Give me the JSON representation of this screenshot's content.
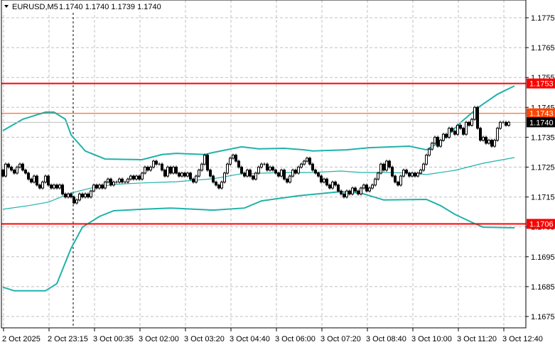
{
  "header": {
    "symbol_timeframe": "EURUSD,M5",
    "ohlc": "1.1740 1.1740 1.1739 1.1740",
    "menu_icon": "triangle-down-icon"
  },
  "chart_data": {
    "type": "candlestick",
    "title": "EURUSD,M5",
    "ylim": [
      1.1668,
      1.1782
    ],
    "grid": true,
    "price_ticks": [
      "1.1775",
      "1.1765",
      "1.1755",
      "1.1745",
      "1.1735",
      "1.1725",
      "1.1715",
      "1.1705",
      "1.1695",
      "1.1685",
      "1.1675"
    ],
    "time_ticks": [
      "2 Oct 2025",
      "2 Oct 23:15",
      "3 Oct 00:35",
      "3 Oct 02:00",
      "3 Oct 03:20",
      "3 Oct 04:40",
      "3 Oct 06:00",
      "3 Oct 07:20",
      "3 Oct 08:40",
      "3 Oct 10:00",
      "3 Oct 11:20",
      "3 Oct 12:40"
    ],
    "colors": {
      "bull_body": "#ffffff",
      "bear_body": "#000000",
      "candle_outline": "#000000",
      "bands": "#20b2aa",
      "grid": "#c0c0c0"
    },
    "closes": [
      1.1722,
      1.1726,
      1.1725,
      1.1724,
      1.1723,
      1.1725,
      1.1726,
      1.1724,
      1.1723,
      1.1721,
      1.172,
      1.1722,
      1.1719,
      1.1718,
      1.172,
      1.1722,
      1.1719,
      1.1718,
      1.1719,
      1.1718,
      1.1719,
      1.1716,
      1.1715,
      1.1716,
      1.1715,
      1.1713,
      1.1714,
      1.1716,
      1.1715,
      1.1716,
      1.1715,
      1.1717,
      1.1719,
      1.1718,
      1.1719,
      1.1718,
      1.172,
      1.1721,
      1.1719,
      1.172,
      1.172,
      1.1721,
      1.172,
      1.172,
      1.1721,
      1.1722,
      1.1721,
      1.1722,
      1.1721,
      1.1723,
      1.1725,
      1.1724,
      1.1725,
      1.1727,
      1.1726,
      1.1726,
      1.1724,
      1.1722,
      1.1725,
      1.1723,
      1.1725,
      1.1723,
      1.1722,
      1.1723,
      1.1722,
      1.1723,
      1.1721,
      1.172,
      1.1722,
      1.1724,
      1.1726,
      1.1729,
      1.1724,
      1.1722,
      1.172,
      1.1719,
      1.1718,
      1.172,
      1.1723,
      1.1726,
      1.1728,
      1.1729,
      1.1727,
      1.1725,
      1.1723,
      1.1722,
      1.1724,
      1.1722,
      1.1721,
      1.1723,
      1.1725,
      1.1726,
      1.1726,
      1.1724,
      1.1725,
      1.1724,
      1.1723,
      1.1722,
      1.1724,
      1.1721,
      1.172,
      1.1722,
      1.1724,
      1.1723,
      1.1725,
      1.1726,
      1.1727,
      1.1728,
      1.1726,
      1.1724,
      1.1723,
      1.1722,
      1.172,
      1.1721,
      1.1719,
      1.1718,
      1.172,
      1.1719,
      1.1717,
      1.1716,
      1.1715,
      1.1717,
      1.1716,
      1.1718,
      1.1717,
      1.1716,
      1.1718,
      1.1719,
      1.1717,
      1.1718,
      1.1719,
      1.1721,
      1.1723,
      1.1726,
      1.1724,
      1.1727,
      1.1725,
      1.1722,
      1.172,
      1.1719,
      1.1722,
      1.1724,
      1.1723,
      1.1722,
      1.1723,
      1.1722,
      1.1723,
      1.1724,
      1.1726,
      1.1729,
      1.1731,
      1.1733,
      1.1735,
      1.1732,
      1.1734,
      1.1736,
      1.1735,
      1.1738,
      1.1737,
      1.1736,
      1.1739,
      1.1738,
      1.1736,
      1.174,
      1.1739,
      1.1741,
      1.1745,
      1.1738,
      1.1734,
      1.1735,
      1.1733,
      1.1734,
      1.1732,
      1.1734,
      1.1738,
      1.174,
      1.174,
      1.1739,
      1.174
    ],
    "bollinger": {
      "upper": [
        [
          0,
          1.17372
        ],
        [
          7,
          1.1741
        ],
        [
          15,
          1.17434
        ],
        [
          18,
          1.17434
        ],
        [
          22,
          1.1741
        ],
        [
          24,
          1.17358
        ],
        [
          29,
          1.17304
        ],
        [
          36,
          1.17277
        ],
        [
          49,
          1.17275
        ],
        [
          56,
          1.17292
        ],
        [
          61,
          1.17296
        ],
        [
          71,
          1.17292
        ],
        [
          74,
          1.17299
        ],
        [
          84,
          1.17318
        ],
        [
          90,
          1.17311
        ],
        [
          99,
          1.17313
        ],
        [
          106,
          1.17308
        ],
        [
          109,
          1.17304
        ],
        [
          121,
          1.17308
        ],
        [
          129,
          1.17315
        ],
        [
          143,
          1.1732
        ],
        [
          149,
          1.17308
        ],
        [
          154,
          1.17334
        ],
        [
          161,
          1.17399
        ],
        [
          167,
          1.17448
        ],
        [
          174,
          1.17494
        ],
        [
          180,
          1.17522
        ]
      ],
      "middle": [
        [
          0,
          1.17109
        ],
        [
          9,
          1.17121
        ],
        [
          16,
          1.17133
        ],
        [
          24,
          1.17163
        ],
        [
          31,
          1.1718
        ],
        [
          39,
          1.17192
        ],
        [
          49,
          1.17197
        ],
        [
          61,
          1.17201
        ],
        [
          74,
          1.17211
        ],
        [
          84,
          1.17228
        ],
        [
          99,
          1.17232
        ],
        [
          109,
          1.17232
        ],
        [
          119,
          1.17237
        ],
        [
          126,
          1.17232
        ],
        [
          134,
          1.17232
        ],
        [
          144,
          1.1723
        ],
        [
          149,
          1.17225
        ],
        [
          159,
          1.17239
        ],
        [
          169,
          1.17263
        ],
        [
          180,
          1.17282
        ]
      ],
      "lower": [
        [
          0,
          1.16848
        ],
        [
          4,
          1.16836
        ],
        [
          15,
          1.16836
        ],
        [
          19,
          1.1686
        ],
        [
          24,
          1.16978
        ],
        [
          28,
          1.17049
        ],
        [
          34,
          1.17085
        ],
        [
          39,
          1.17104
        ],
        [
          49,
          1.17109
        ],
        [
          59,
          1.17113
        ],
        [
          74,
          1.17106
        ],
        [
          85,
          1.17113
        ],
        [
          91,
          1.17137
        ],
        [
          104,
          1.17154
        ],
        [
          119,
          1.17168
        ],
        [
          126,
          1.17163
        ],
        [
          134,
          1.1714
        ],
        [
          149,
          1.17142
        ],
        [
          154,
          1.17121
        ],
        [
          159,
          1.17092
        ],
        [
          166,
          1.17061
        ],
        [
          169,
          1.17049
        ],
        [
          180,
          1.17047
        ]
      ]
    },
    "levels": [
      {
        "price": 1.1753,
        "label": "1.1753",
        "color": "#ff0000",
        "kind": "resistance"
      },
      {
        "price": 1.1743,
        "label": "1.1743",
        "color": "#ff4500",
        "kind": "level"
      },
      {
        "price": 1.174,
        "label": "1.1740",
        "color": "#000000",
        "kind": "bid"
      },
      {
        "price": 1.1706,
        "label": "1.1706",
        "color": "#ff0000",
        "kind": "support"
      }
    ]
  }
}
